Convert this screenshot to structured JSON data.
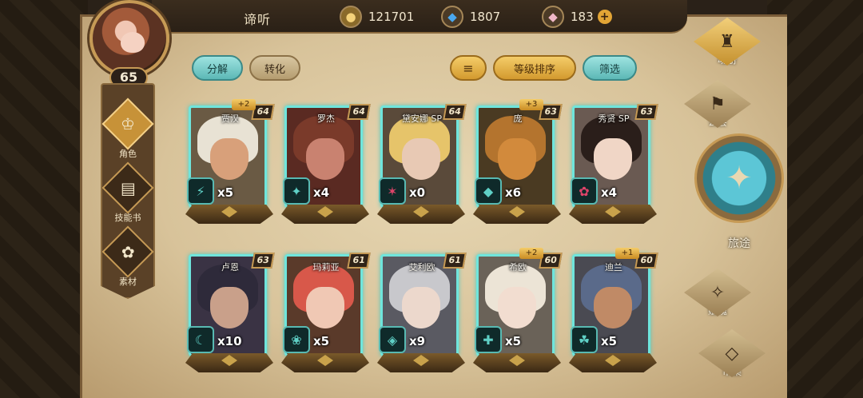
{
  "header": {
    "title": "谛听",
    "player_level": "65",
    "currencies": [
      {
        "icon": "gold-coin-icon",
        "value": "121701"
      },
      {
        "icon": "blue-crystal-icon",
        "value": "1807"
      },
      {
        "icon": "pink-gem-icon",
        "value": "183"
      }
    ],
    "add_label": "+"
  },
  "left_nav": [
    {
      "label": "角色",
      "icon": "character-icon",
      "active": true
    },
    {
      "label": "技能书",
      "icon": "skill-book-icon",
      "active": false
    },
    {
      "label": "素材",
      "icon": "material-icon",
      "active": false
    }
  ],
  "tabs": {
    "decompose": "分解",
    "convert": "转化",
    "sort_icon": "sort-icon",
    "sort_label": "等级排序",
    "filter_label": "筛选"
  },
  "heroes": [
    {
      "name": "贾汉",
      "level": "64",
      "plus": "+2",
      "count": "x5",
      "hair": "#e8e2d4",
      "face": "#d8a07a",
      "bg": "#6a5a44",
      "class_icon": "⚡",
      "class_color": "#5fd0c6"
    },
    {
      "name": "罗杰",
      "level": "64",
      "plus": "",
      "count": "x4",
      "hair": "#7a3a2a",
      "face": "#c98270",
      "bg": "#5a2a22",
      "class_icon": "✦",
      "class_color": "#5fd0c6"
    },
    {
      "name": "黛安娜 SP",
      "level": "64",
      "plus": "",
      "count": "x0",
      "hair": "#e6c46a",
      "face": "#e8c9b4",
      "bg": "#5a4a3a",
      "class_icon": "✶",
      "class_color": "#e0446a"
    },
    {
      "name": "庞",
      "level": "63",
      "plus": "+3",
      "count": "x6",
      "hair": "#b4742e",
      "face": "#d28a3c",
      "bg": "#4a3a22",
      "class_icon": "◆",
      "class_color": "#5fd0c6"
    },
    {
      "name": "秀贤 SP",
      "level": "63",
      "plus": "",
      "count": "x4",
      "hair": "#2a1e1a",
      "face": "#f0d6c6",
      "bg": "#6a5a52",
      "class_icon": "✿",
      "class_color": "#e0446a"
    },
    {
      "name": "卢恩",
      "level": "63",
      "plus": "",
      "count": "x10",
      "hair": "#2e2a3a",
      "face": "#c9a08a",
      "bg": "#3a3344",
      "class_icon": "☾",
      "class_color": "#5fd0c6"
    },
    {
      "name": "玛莉亚",
      "level": "61",
      "plus": "",
      "count": "x5",
      "hair": "#d8584a",
      "face": "#f0c8b4",
      "bg": "#5a3a2a",
      "class_icon": "❀",
      "class_color": "#5fd0c6"
    },
    {
      "name": "艾利欧",
      "level": "61",
      "plus": "",
      "count": "x9",
      "hair": "#c8c8cc",
      "face": "#ecd8cc",
      "bg": "#5a5a62",
      "class_icon": "◈",
      "class_color": "#5fd0c6"
    },
    {
      "name": "希欧",
      "level": "60",
      "plus": "+2",
      "count": "x5",
      "hair": "#ece4d6",
      "face": "#f2ddd0",
      "bg": "#6a6258",
      "class_icon": "✚",
      "class_color": "#5fd0c6"
    },
    {
      "name": "迪兰",
      "level": "60",
      "plus": "+1",
      "count": "x5",
      "hair": "#5a6a8a",
      "face": "#c08a66",
      "bg": "#4a4a52",
      "class_icon": "☘",
      "class_color": "#5fd0c6"
    }
  ],
  "right_nav": [
    {
      "label": "魂册",
      "icon": "soul-book-icon",
      "active": true
    },
    {
      "label": "公会",
      "icon": "guild-icon",
      "active": false
    },
    {
      "label": "旅途",
      "icon": "journey-icon",
      "active": false
    },
    {
      "label": "赋魂",
      "icon": "soul-infuse-icon",
      "active": false
    },
    {
      "label": "市集",
      "icon": "market-icon",
      "active": false
    }
  ]
}
